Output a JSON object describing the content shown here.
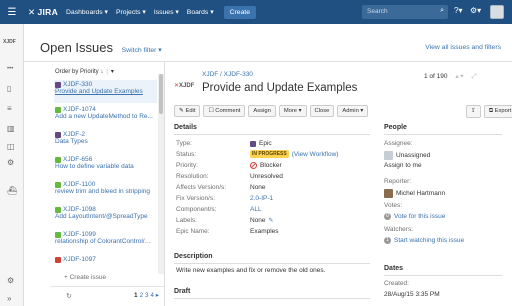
{
  "topnav": {
    "logo_text": "JIRA",
    "menus": [
      "Dashboards ▾",
      "Projects ▾",
      "Issues ▾",
      "Boards ▾"
    ],
    "create_label": "Create",
    "search_placeholder": "Search",
    "help_label": "?▾",
    "settings_label": "▾"
  },
  "sidebar": {
    "project_logo_text": "XJDF",
    "more_label": "•••"
  },
  "header": {
    "title": "Open Issues",
    "switch_filter": "Switch filter ▾",
    "view_all": "View all issues and filters"
  },
  "list": {
    "order_label": "Order by Priority ↓",
    "order_caret": "▾",
    "items": [
      {
        "key": "XJDF-330",
        "summary": "Provide and Update Examples",
        "type": "epic",
        "selected": true
      },
      {
        "key": "XJDF-1074",
        "summary": "Add a new UpdateMethod to Re...",
        "type": "story"
      },
      {
        "key": "XJDF-2",
        "summary": "Data Types",
        "type": "epic"
      },
      {
        "key": "XJDF-656",
        "summary": "How to define variable data",
        "type": "story"
      },
      {
        "key": "XJDF-1100",
        "summary": "review trim and bleed in stripping",
        "type": "story"
      },
      {
        "key": "XJDF-1098",
        "summary": "Add LayoutIntent/@SpreadType",
        "type": "story"
      },
      {
        "key": "XJDF-1099",
        "summary": "relationship of ColorantControl/@...",
        "type": "story"
      },
      {
        "key": "XJDF-1097",
        "summary": "",
        "type": "bug"
      }
    ],
    "create_issue": "+ Create issue",
    "refresh": "↻",
    "pages": [
      "1",
      "2",
      "3",
      "4"
    ],
    "next": "▸"
  },
  "detail": {
    "logo": "XJDF",
    "breadcrumb": "XJDF / XJDF-330",
    "title": "Provide and Update Examples",
    "count": "1 of 190",
    "buttons": [
      "✎ Edit",
      "☐ Comment",
      "Assign",
      "More ▾",
      "Close",
      "Admin ▾"
    ],
    "export_icon": "⇪",
    "export_label": "⧉ Export ▾",
    "details_heading": "Details",
    "fields": [
      {
        "label": "Type:",
        "value": "Epic"
      },
      {
        "label": "Status:",
        "value": "IN PROGRESS",
        "extra": "(View Workflow)"
      },
      {
        "label": "Priority:",
        "value": "Blocker"
      },
      {
        "label": "Resolution:",
        "value": "Unresolved"
      },
      {
        "label": "Affects Version/s:",
        "value": "None"
      },
      {
        "label": "Fix Version/s:",
        "value": "2.0-IP-1"
      },
      {
        "label": "Component/s:",
        "value": "ALL"
      },
      {
        "label": "Labels:",
        "value": "None"
      },
      {
        "label": "Epic Name:",
        "value": "Examples"
      }
    ],
    "description_heading": "Description",
    "description": "Write new examples and fix or remove the old ones.",
    "draft_heading": "Draft"
  },
  "people": {
    "heading": "People",
    "assignee_label": "Assignee:",
    "assignee": "Unassigned",
    "assign_to_me": "Assign to me",
    "reporter_label": "Reporter:",
    "reporter": "Michel Hartmann",
    "votes_label": "Votes:",
    "votes_count": "0",
    "vote_link": "Vote for this issue",
    "watchers_label": "Watchers:",
    "watchers_count": "1",
    "watch_link": "Start watching this issue"
  },
  "dates": {
    "heading": "Dates",
    "created_label": "Created:",
    "created": "28/Aug/15 3:35 PM"
  }
}
